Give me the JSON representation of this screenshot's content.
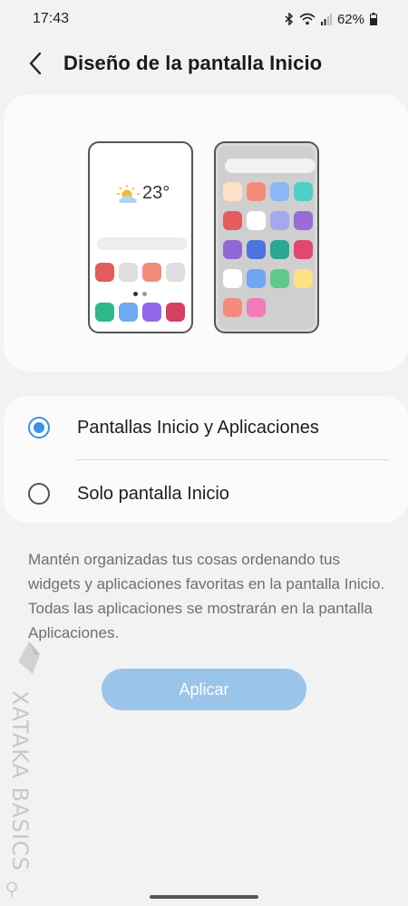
{
  "status_bar": {
    "time": "17:43",
    "battery": "62%",
    "icons": [
      "bluetooth-icon",
      "wifi-icon",
      "signal-icon",
      "battery-icon"
    ]
  },
  "header": {
    "title": "Diseño de la pantalla Inicio",
    "back_icon": "chevron-left-icon"
  },
  "preview": {
    "weather_temp": "23°",
    "layout_one_icons": [
      "#e35d5d",
      "#dedede",
      "#f48c7b",
      "#dedede",
      "#2fb88a",
      "#6fa9f2",
      "#9068e8",
      "#d64060"
    ],
    "layout_two_icons": [
      "#fde0c8",
      "#f48c7b",
      "#8fb7f5",
      "#4fcfc6",
      "#e35d5d",
      "#ffffff",
      "#a4a8f0",
      "#9a6cd6",
      "#9068d6",
      "#4a74e0",
      "#2aa895",
      "#e0486e",
      "#ffffff",
      "#6ea8f2",
      "#5ec98a",
      "#ffe082",
      "#f48c7b",
      "#f07cb8"
    ]
  },
  "options": [
    {
      "label": "Pantallas Inicio y Aplicaciones",
      "selected": true
    },
    {
      "label": "Solo pantalla Inicio",
      "selected": false
    }
  ],
  "description": "Mantén organizadas tus cosas ordenando tus widgets y aplicaciones favoritas en la pantalla Inicio. Todas las aplicaciones se mostrarán en la pantalla Aplicaciones.",
  "apply_label": "Aplicar",
  "watermark": "XATAKA BASICS",
  "colors": {
    "accent": "#3e91e4",
    "apply_button": "#9ac4e9",
    "background": "#f2f2f2"
  }
}
